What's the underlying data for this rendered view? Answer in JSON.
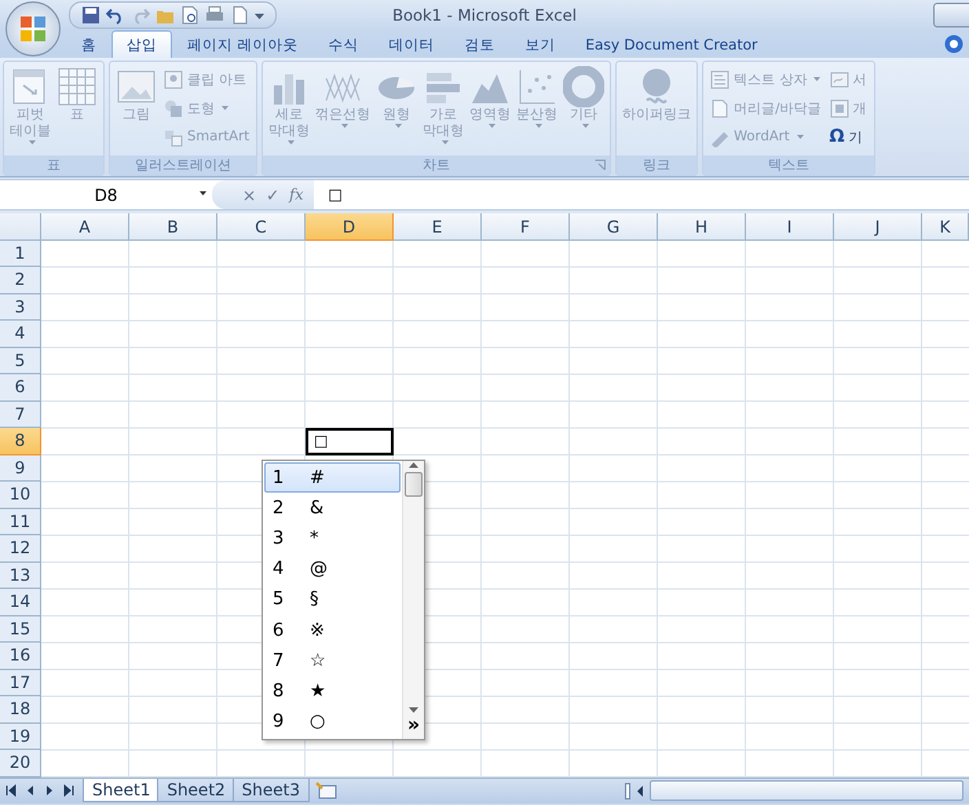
{
  "window": {
    "title": "Book1 - Microsoft Excel"
  },
  "tabs": [
    {
      "label": "홈",
      "selected": false
    },
    {
      "label": "삽입",
      "selected": true
    },
    {
      "label": "페이지 레이아웃",
      "selected": false
    },
    {
      "label": "수식",
      "selected": false
    },
    {
      "label": "데이터",
      "selected": false
    },
    {
      "label": "검토",
      "selected": false
    },
    {
      "label": "보기",
      "selected": false
    },
    {
      "label": "Easy Document Creator",
      "selected": false
    }
  ],
  "ribbon": {
    "disabled": true,
    "groups": [
      {
        "label": "표",
        "items": [
          {
            "kind": "large",
            "label": "피벗\n테이블",
            "dropdown": true
          },
          {
            "kind": "large",
            "label": "표",
            "dropdown": false
          }
        ]
      },
      {
        "label": "일러스트레이션",
        "items": [
          {
            "kind": "large",
            "label": "그림",
            "dropdown": false
          },
          {
            "kind": "small",
            "label": "클립 아트",
            "dropdown": false
          },
          {
            "kind": "small",
            "label": "도형",
            "dropdown": true
          },
          {
            "kind": "small",
            "label": "SmartArt",
            "dropdown": false
          }
        ]
      },
      {
        "label": "차트",
        "launcher": true,
        "items": [
          {
            "kind": "large",
            "label": "세로\n막대형",
            "dropdown": true
          },
          {
            "kind": "large",
            "label": "꺾은선형",
            "dropdown": true
          },
          {
            "kind": "large",
            "label": "원형",
            "dropdown": true
          },
          {
            "kind": "large",
            "label": "가로\n막대형",
            "dropdown": true
          },
          {
            "kind": "large",
            "label": "영역형",
            "dropdown": true
          },
          {
            "kind": "large",
            "label": "분산형",
            "dropdown": true
          },
          {
            "kind": "large",
            "label": "기타",
            "dropdown": true
          }
        ]
      },
      {
        "label": "링크",
        "items": [
          {
            "kind": "large",
            "label": "하이퍼링크",
            "dropdown": false
          }
        ]
      },
      {
        "label": "텍스트",
        "items": [
          {
            "kind": "small",
            "label": "텍스트 상자",
            "dropdown": true
          },
          {
            "kind": "small",
            "label": "머리글/바닥글",
            "dropdown": false
          },
          {
            "kind": "small",
            "label": "WordArt",
            "dropdown": true
          },
          {
            "kind": "small",
            "label": "서",
            "dropdown": false
          },
          {
            "kind": "small",
            "label": "개",
            "dropdown": false
          },
          {
            "kind": "glyph",
            "glyph": "Ω",
            "label": "기",
            "dropdown": false
          }
        ]
      }
    ]
  },
  "formula_bar": {
    "name_box": "D8",
    "buttons": [
      "×",
      "✓",
      "fx"
    ],
    "content": "□"
  },
  "grid": {
    "columns": [
      {
        "label": "A",
        "selected": false
      },
      {
        "label": "B",
        "selected": false
      },
      {
        "label": "C",
        "selected": false
      },
      {
        "label": "D",
        "selected": true
      },
      {
        "label": "E",
        "selected": false
      },
      {
        "label": "F",
        "selected": false
      },
      {
        "label": "G",
        "selected": false
      },
      {
        "label": "H",
        "selected": false
      },
      {
        "label": "I",
        "selected": false
      },
      {
        "label": "J",
        "selected": false
      },
      {
        "label": "K",
        "selected": false
      }
    ],
    "rows": [
      {
        "label": "1",
        "selected": false
      },
      {
        "label": "2",
        "selected": false
      },
      {
        "label": "3",
        "selected": false
      },
      {
        "label": "4",
        "selected": false
      },
      {
        "label": "5",
        "selected": false
      },
      {
        "label": "6",
        "selected": false
      },
      {
        "label": "7",
        "selected": false
      },
      {
        "label": "8",
        "selected": true
      },
      {
        "label": "9",
        "selected": false
      },
      {
        "label": "10",
        "selected": false
      },
      {
        "label": "11",
        "selected": false
      },
      {
        "label": "12",
        "selected": false
      },
      {
        "label": "13",
        "selected": false
      },
      {
        "label": "14",
        "selected": false
      },
      {
        "label": "15",
        "selected": false
      },
      {
        "label": "16",
        "selected": false
      },
      {
        "label": "17",
        "selected": false
      },
      {
        "label": "18",
        "selected": false
      },
      {
        "label": "19",
        "selected": false
      },
      {
        "label": "20",
        "selected": false
      }
    ],
    "active_cell_value": "□"
  },
  "suggestions": {
    "items": [
      {
        "number": "1",
        "symbol": "#",
        "selected": true
      },
      {
        "number": "2",
        "symbol": "&",
        "selected": false
      },
      {
        "number": "3",
        "symbol": "*",
        "selected": false
      },
      {
        "number": "4",
        "symbol": "@",
        "selected": false
      },
      {
        "number": "5",
        "symbol": "§",
        "selected": false
      },
      {
        "number": "6",
        "symbol": "※",
        "selected": false
      },
      {
        "number": "7",
        "symbol": "☆",
        "selected": false
      },
      {
        "number": "8",
        "symbol": "★",
        "selected": false
      },
      {
        "number": "9",
        "symbol": "○",
        "selected": false
      }
    ],
    "expand": "»"
  },
  "sheet_tabs": [
    {
      "label": "Sheet1",
      "selected": true
    },
    {
      "label": "Sheet2",
      "selected": false
    },
    {
      "label": "Sheet3",
      "selected": false
    }
  ]
}
